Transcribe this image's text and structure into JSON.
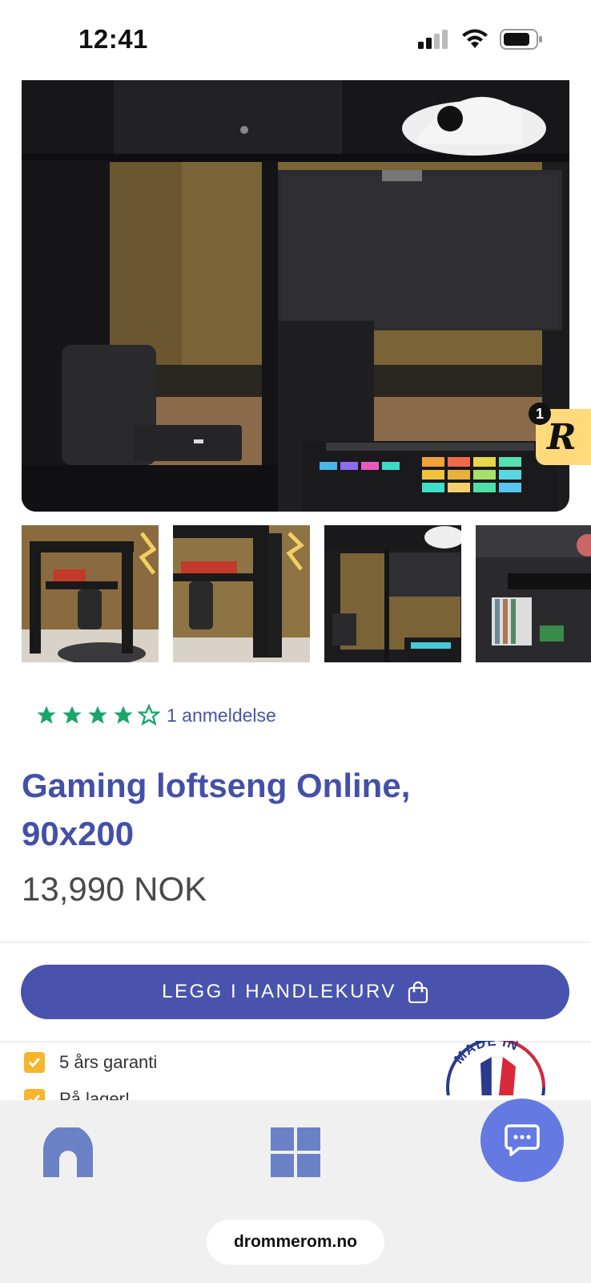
{
  "status": {
    "time": "12:41"
  },
  "product": {
    "rating": {
      "stars": 4,
      "max": 5,
      "reviews_label": "1 anmeldelse"
    },
    "title": "Gaming loftseng Online, 90x200",
    "price": "13,990 NOK"
  },
  "badge": {
    "count": "1",
    "logo": "R"
  },
  "cart": {
    "button_label": "LEGG I HANDLEKURV",
    "icon": "shopping-bag-icon"
  },
  "benefits": [
    "5 års garanti",
    "På lager!"
  ],
  "made_in": {
    "text": "MADE IN"
  },
  "nav": {
    "items": [
      "home-icon",
      "grid-icon"
    ]
  },
  "browser": {
    "url": "drommerom.no"
  },
  "colors": {
    "accent": "#4953ad",
    "stars": "#1aa56b",
    "check": "#f7b52b",
    "chat": "#6479e2"
  }
}
